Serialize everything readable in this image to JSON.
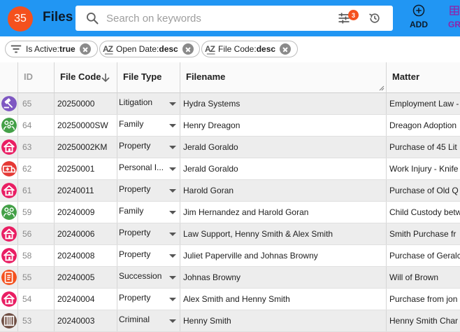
{
  "header": {
    "count": "35",
    "title": "Files",
    "search_placeholder": "Search on keywords",
    "filter_count": "3",
    "add_label": "ADD",
    "group_label": "GR"
  },
  "chips": [
    {
      "label": "Is Active:",
      "value": "true"
    },
    {
      "label": "Open Date:",
      "value": "desc"
    },
    {
      "label": "File Code:",
      "value": "desc"
    }
  ],
  "columns": {
    "id": "ID",
    "file_code": "File Code",
    "file_type": "File Type",
    "filename": "Filename",
    "matter": "Matter"
  },
  "rows": [
    {
      "icon": "gavel-icon",
      "icon_color": "#7e57c2",
      "id": "65",
      "code": "20250000",
      "type": "Litigation",
      "filename": "Hydra Systems",
      "matter": "Employment Law -"
    },
    {
      "icon": "family-icon",
      "icon_color": "#43a047",
      "id": "64",
      "code": "20250000SW",
      "type": "Family",
      "filename": "Henry Dreagon",
      "matter": "Dreagon Adoption"
    },
    {
      "icon": "house-icon",
      "icon_color": "#e91e63",
      "id": "63",
      "code": "20250002KM",
      "type": "Property",
      "filename": "Jerald Goraldo",
      "matter": "Purchase of 45 Lit"
    },
    {
      "icon": "ambulance-icon",
      "icon_color": "#e53935",
      "id": "62",
      "code": "20250001",
      "type": "Personal I...",
      "filename": "Jerald Goraldo",
      "matter": "Work Injury - Knife"
    },
    {
      "icon": "house-icon",
      "icon_color": "#e91e63",
      "id": "61",
      "code": "20240011",
      "type": "Property",
      "filename": "Harold Goran",
      "matter": "Purchase of Old Q"
    },
    {
      "icon": "family-icon",
      "icon_color": "#43a047",
      "id": "59",
      "code": "20240009",
      "type": "Family",
      "filename": "Jim Hernandez and Harold Goran",
      "matter": "Child Custody betw"
    },
    {
      "icon": "house-icon",
      "icon_color": "#e91e63",
      "id": "56",
      "code": "20240006",
      "type": "Property",
      "filename": "Law Support, Henny Smith & Alex Smith",
      "matter": "Smith Purchase fr"
    },
    {
      "icon": "house-icon",
      "icon_color": "#e91e63",
      "id": "58",
      "code": "20240008",
      "type": "Property",
      "filename": "Juliet Paperville and Johnas Browny",
      "matter": "Purchase of Geralc"
    },
    {
      "icon": "scroll-icon",
      "icon_color": "#f4511e",
      "id": "55",
      "code": "20240005",
      "type": "Succession",
      "filename": "Johnas Browny",
      "matter": "Will of Brown"
    },
    {
      "icon": "house-icon",
      "icon_color": "#e91e63",
      "id": "54",
      "code": "20240004",
      "type": "Property",
      "filename": "Alex Smith and Henny Smith",
      "matter": "Purchase from jon"
    },
    {
      "icon": "prison-icon",
      "icon_color": "#6d4c41",
      "id": "53",
      "code": "20240003",
      "type": "Criminal",
      "filename": "Henny Smith",
      "matter": "Henny Smith Char"
    }
  ],
  "colors": {
    "topbar": "#2196f3",
    "badge": "#f4511e",
    "alt_row": "#ededed"
  }
}
